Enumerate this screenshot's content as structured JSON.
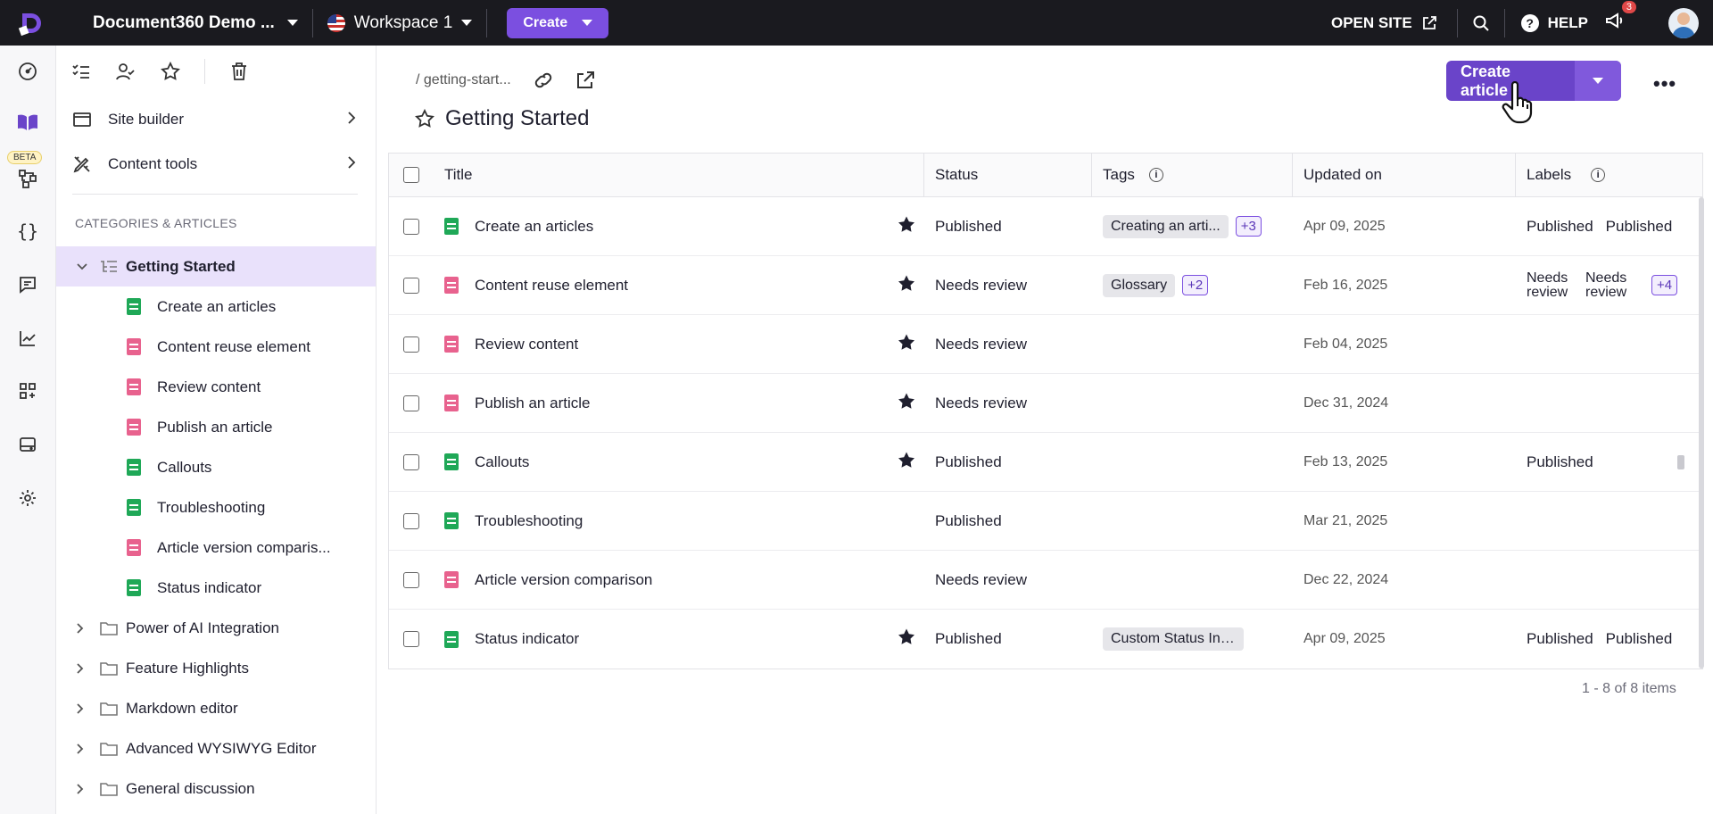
{
  "topbar": {
    "project_name": "Document360 Demo ...",
    "workspace": "Workspace 1",
    "create_label": "Create",
    "open_site_label": "OPEN SITE",
    "help_label": "HELP",
    "notification_count": "3"
  },
  "rail": {
    "beta_label": "BETA"
  },
  "sidebar": {
    "menu": [
      {
        "label": "Site builder"
      },
      {
        "label": "Content tools"
      }
    ],
    "section_heading": "CATEGORIES & ARTICLES",
    "active_category": "Getting Started",
    "articles": [
      {
        "title": "Create an articles",
        "status_color": "green"
      },
      {
        "title": "Content reuse element",
        "status_color": "pink"
      },
      {
        "title": "Review content",
        "status_color": "pink"
      },
      {
        "title": "Publish an article",
        "status_color": "pink"
      },
      {
        "title": "Callouts",
        "status_color": "green"
      },
      {
        "title": "Troubleshooting",
        "status_color": "green"
      },
      {
        "title": "Article version comparis...",
        "status_color": "pink"
      },
      {
        "title": "Status indicator",
        "status_color": "green"
      }
    ],
    "categories": [
      {
        "label": "Power of AI Integration"
      },
      {
        "label": "Feature Highlights"
      },
      {
        "label": "Markdown editor"
      },
      {
        "label": "Advanced WYSIWYG Editor"
      },
      {
        "label": "General discussion"
      }
    ]
  },
  "main": {
    "breadcrumb": "/ getting-start...",
    "title": "Getting Started",
    "create_article_label": "Create article",
    "more_label": "•••",
    "columns": {
      "title": "Title",
      "status": "Status",
      "tags": "Tags",
      "updated": "Updated on",
      "labels": "Labels"
    },
    "rows": [
      {
        "title": "Create an articles",
        "color": "green",
        "starred": true,
        "status": "Published",
        "tag": "Creating an arti...",
        "more_tags": "+3",
        "updated": "Apr 09, 2025",
        "labels": [
          "Published",
          "Published"
        ]
      },
      {
        "title": "Content reuse element",
        "color": "pink",
        "starred": true,
        "status": "Needs review",
        "tag": "Glossary",
        "more_tags": "+2",
        "updated": "Feb 16, 2025",
        "labels": [
          "Needs review",
          "Needs review"
        ],
        "more_labels": "+4"
      },
      {
        "title": "Review content",
        "color": "pink",
        "starred": true,
        "status": "Needs review",
        "tag": "",
        "more_tags": "",
        "updated": "Feb 04, 2025",
        "labels": []
      },
      {
        "title": "Publish an article",
        "color": "pink",
        "starred": true,
        "status": "Needs review",
        "tag": "",
        "more_tags": "",
        "updated": "Dec 31, 2024",
        "labels": []
      },
      {
        "title": "Callouts",
        "color": "green",
        "starred": true,
        "status": "Published",
        "tag": "",
        "more_tags": "",
        "updated": "Feb 13, 2025",
        "labels": [
          "Published"
        ]
      },
      {
        "title": "Troubleshooting",
        "color": "green",
        "starred": false,
        "status": "Published",
        "tag": "",
        "more_tags": "",
        "updated": "Mar 21, 2025",
        "labels": []
      },
      {
        "title": "Article version comparison",
        "color": "pink",
        "starred": false,
        "status": "Needs review",
        "tag": "",
        "more_tags": "",
        "updated": "Dec 22, 2024",
        "labels": []
      },
      {
        "title": "Status indicator",
        "color": "green",
        "starred": true,
        "status": "Published",
        "tag": "Custom Status Indica...",
        "more_tags": "",
        "updated": "Apr 09, 2025",
        "labels": [
          "Published",
          "Published"
        ]
      }
    ],
    "pager": "1 - 8 of 8 items"
  },
  "colors": {
    "accent": "#7b4fe0",
    "topbar_bg": "#1a1a1f",
    "published_doc": "#1fa857",
    "review_doc": "#e8628e"
  }
}
